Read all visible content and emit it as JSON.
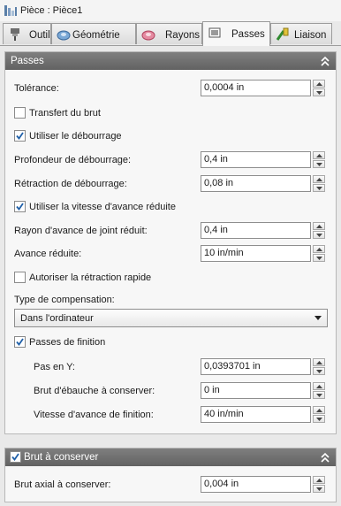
{
  "window": {
    "title": "Pièce : Pièce1"
  },
  "tabs": [
    {
      "label": "Outil",
      "icon": "tool-icon"
    },
    {
      "label": "Géométrie",
      "icon": "geometry-icon"
    },
    {
      "label": "Rayons",
      "icon": "radii-icon"
    },
    {
      "label": "Passes",
      "icon": "passes-icon",
      "active": true
    },
    {
      "label": "Liaison",
      "icon": "linking-icon"
    }
  ],
  "passes": {
    "title": "Passes",
    "tolerance": {
      "label": "Tolérance:",
      "value": "0,0004 in"
    },
    "transfert_brut": {
      "label": "Transfert du brut",
      "checked": false
    },
    "debourrage": {
      "label": "Utiliser le débourrage",
      "checked": true
    },
    "profondeur_debourrage": {
      "label": "Profondeur de débourrage:",
      "value": "0,4 in"
    },
    "retraction_debourrage": {
      "label": "Rétraction de débourrage:",
      "value": "0,08 in"
    },
    "vitesse_reduite": {
      "label": "Utiliser la vitesse d'avance réduite",
      "checked": true
    },
    "rayon_avance": {
      "label": "Rayon d'avance de joint réduit:",
      "value": "0,4 in"
    },
    "avance_reduite": {
      "label": "Avance réduite:",
      "value": "10 in/min"
    },
    "retraction_rapide": {
      "label": "Autoriser la rétraction rapide",
      "checked": false
    },
    "compensation": {
      "label": "Type de compensation:",
      "value": "Dans l'ordinateur"
    },
    "finition": {
      "label": "Passes de finition",
      "checked": true
    },
    "pas_y": {
      "label": "Pas en Y:",
      "value": "0,0393701 in"
    },
    "brut_ebauche": {
      "label": "Brut d'ébauche à conserver:",
      "value": "0 in"
    },
    "vitesse_finition": {
      "label": "Vitesse d'avance de finition:",
      "value": "40 in/min"
    }
  },
  "brut": {
    "title": "Brut à conserver",
    "checked": true,
    "axial": {
      "label": "Brut axial à conserver:",
      "value": "0,004 in"
    }
  }
}
